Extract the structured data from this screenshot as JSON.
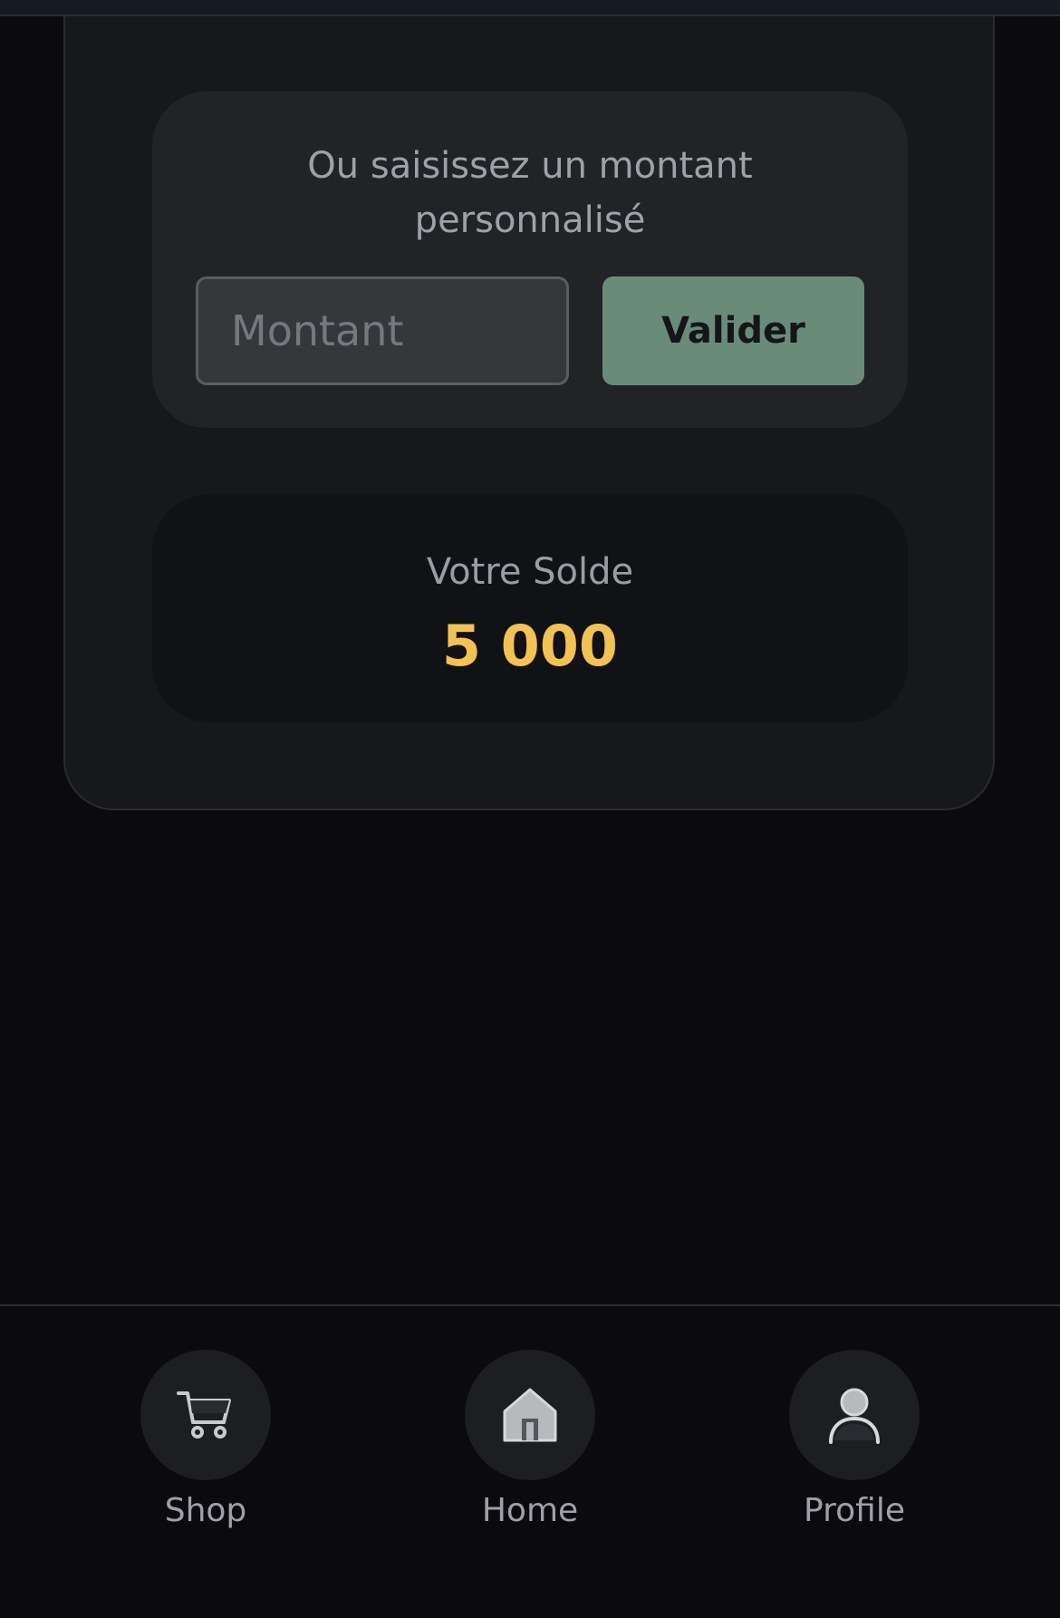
{
  "amount_chips": [
    {
      "color": "#a877ee"
    },
    {
      "color": "#3fb58d"
    },
    {
      "color": "#5b8fea"
    }
  ],
  "custom_amount": {
    "prompt_line1": "Ou saisissez un montant",
    "prompt_line2": "personnalisé",
    "input_placeholder": "Montant",
    "input_value": "",
    "validate_label": "Valider"
  },
  "balance": {
    "label": "Votre Solde",
    "value": "5 000"
  },
  "bottom_nav": {
    "items": [
      {
        "label": "Shop",
        "icon": "cart-icon"
      },
      {
        "label": "Home",
        "icon": "home-icon"
      },
      {
        "label": "Profile",
        "icon": "user-icon"
      }
    ]
  },
  "colors": {
    "background": "#0b0b0f",
    "card": "#17181c",
    "accent_button": "#6b8b79",
    "balance_value": "#f3c254"
  }
}
